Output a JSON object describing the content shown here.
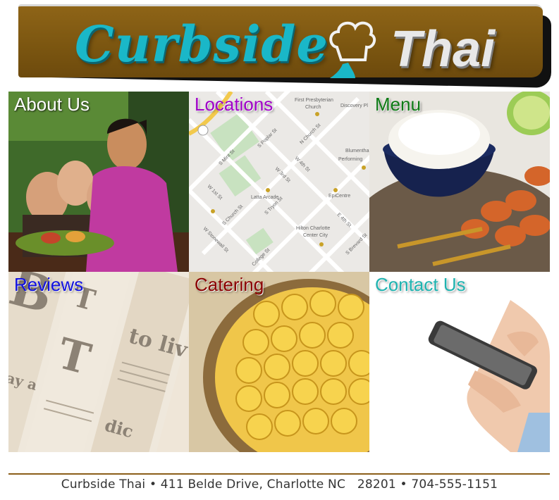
{
  "banner": {
    "logo_word_1": "Curbside",
    "logo_word_2": "Thai",
    "logo_icon": "chef-hat-icon",
    "colors": {
      "banner_bg": "#7a5510",
      "curbside_teal": "#1ab7c8",
      "thai_silver": "#e8e8e8"
    }
  },
  "tiles": {
    "about": {
      "label": "About Us",
      "color": "#ffffff"
    },
    "locations": {
      "label": "Locations",
      "color": "#a000c8",
      "map_labels": [
        "First Presbyterian Church",
        "Discovery Pl",
        "S Mint St",
        "S Poplar St",
        "N Church St",
        "W 3rd St",
        "W 4th St",
        "Blumenthal Performing",
        "Latta Arcade",
        "W 1st St",
        "S Church St",
        "S Tryon St",
        "Epicentre",
        "E 4th St",
        "W Stonewall St",
        "Hilton Charlotte Center City",
        "College St",
        "S Brevard St"
      ]
    },
    "menu": {
      "label": "Menu",
      "color": "#0d7a14"
    },
    "reviews": {
      "label": "Reviews",
      "color": "#1010e0"
    },
    "catering": {
      "label": "Catering",
      "color": "#8b0000"
    },
    "contact": {
      "label": "Contact Us",
      "color": "#1fb3b0"
    }
  },
  "footer": {
    "text": "Curbside Thai • 411 Belde Drive, Charlotte NC   28201 • 704-555-1151",
    "rule_color": "#8b5e1a"
  }
}
